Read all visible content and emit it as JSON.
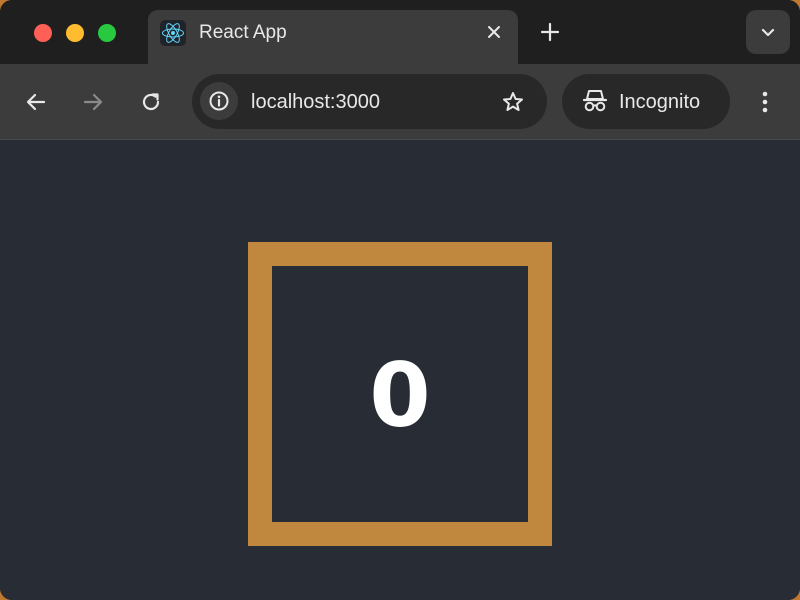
{
  "tab": {
    "title": "React App",
    "favicon": "react-icon"
  },
  "address_bar": {
    "url": "localhost:3000"
  },
  "profile": {
    "label": "Incognito"
  },
  "counter": {
    "value": "0"
  },
  "colors": {
    "page_background": "#282c34",
    "box_border": "#c0883e",
    "counter_text": "#ffffff"
  }
}
